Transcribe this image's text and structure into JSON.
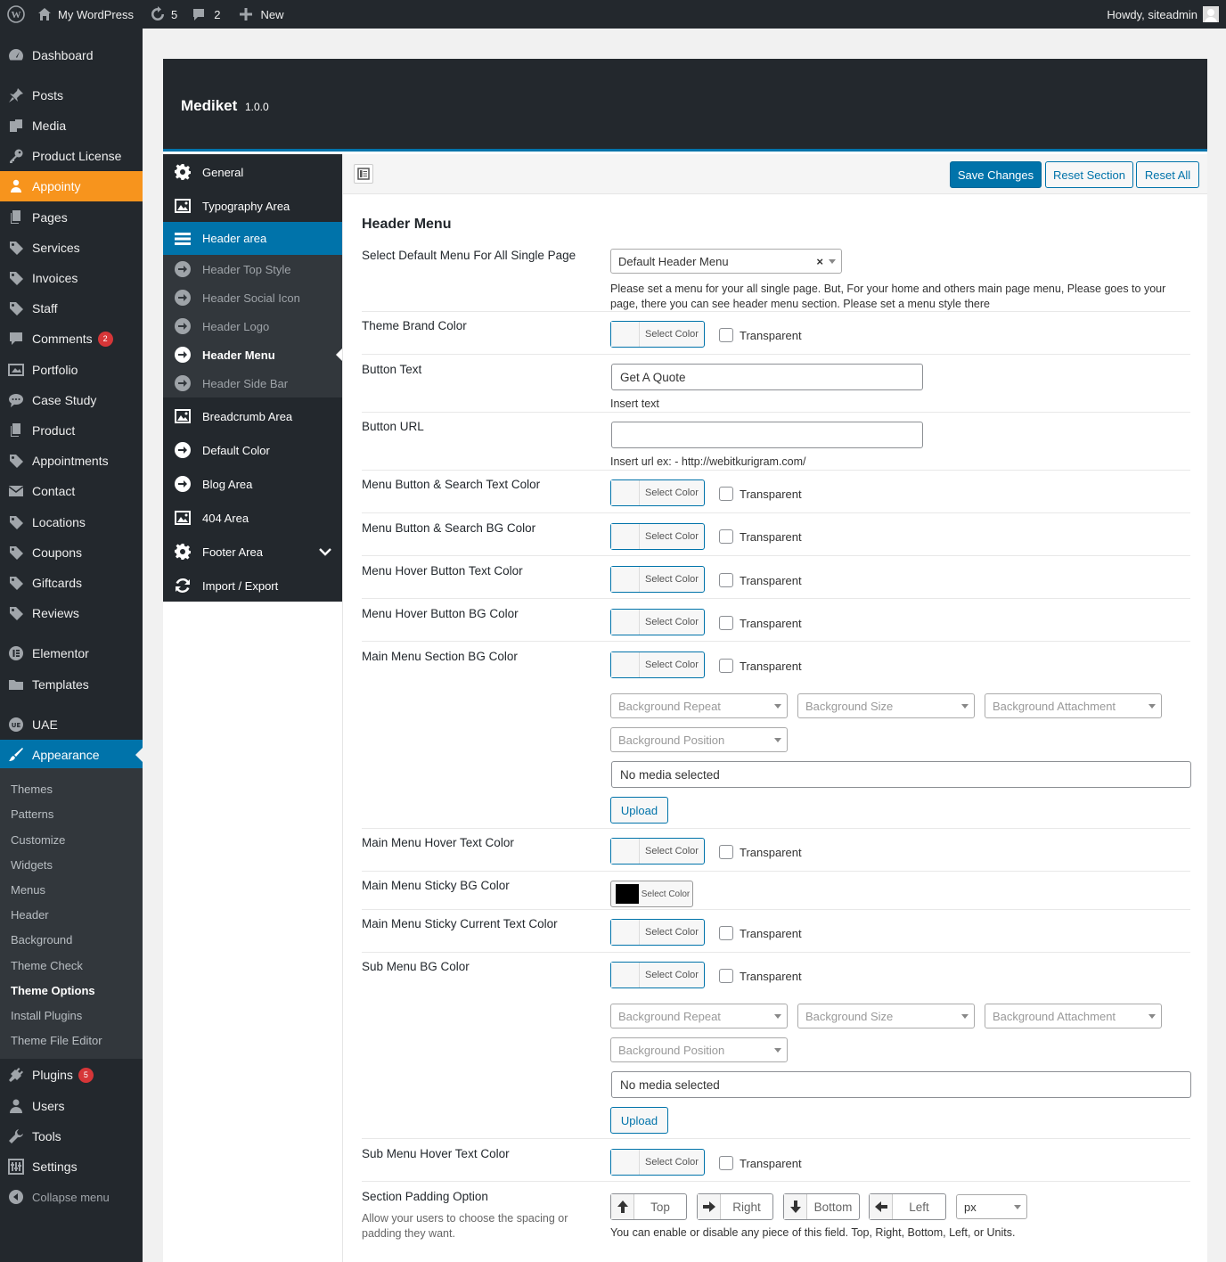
{
  "adminbar": {
    "site_name": "My WordPress",
    "updates_count": "5",
    "comments_count": "2",
    "new_label": "New",
    "howdy": "Howdy, siteadmin"
  },
  "menu": {
    "dashboard": "Dashboard",
    "posts": "Posts",
    "media": "Media",
    "product_license": "Product License",
    "appointy": "Appointy",
    "pages": "Pages",
    "services": "Services",
    "invoices": "Invoices",
    "staff": "Staff",
    "comments": "Comments",
    "comments_badge": "2",
    "portfolio": "Portfolio",
    "case_study": "Case Study",
    "product": "Product",
    "appointments": "Appointments",
    "contact": "Contact",
    "locations": "Locations",
    "coupons": "Coupons",
    "giftcards": "Giftcards",
    "reviews": "Reviews",
    "elementor": "Elementor",
    "templates": "Templates",
    "uae": "UAE",
    "appearance": "Appearance",
    "plugins": "Plugins",
    "plugins_badge": "5",
    "users": "Users",
    "tools": "Tools",
    "settings": "Settings",
    "collapse": "Collapse menu"
  },
  "appearance_sub": {
    "themes": "Themes",
    "patterns": "Patterns",
    "customize": "Customize",
    "widgets": "Widgets",
    "menus": "Menus",
    "header": "Header",
    "background": "Background",
    "theme_check": "Theme Check",
    "theme_options": "Theme Options",
    "install_plugins": "Install Plugins",
    "theme_file_editor": "Theme File Editor"
  },
  "panel": {
    "title": "Mediket",
    "version": "1.0.0"
  },
  "opt_nav": {
    "general": "General",
    "typography": "Typography Area",
    "header_area": "Header area",
    "header_top_style": "Header Top Style",
    "header_social_icon": "Header Social Icon",
    "header_logo": "Header Logo",
    "header_menu": "Header Menu",
    "header_side_bar": "Header Side Bar",
    "breadcrumb": "Breadcrumb Area",
    "default_color": "Default Color",
    "blog_area": "Blog Area",
    "area_404": "404 Area",
    "footer_area": "Footer Area",
    "import_export": "Import / Export"
  },
  "toolbar": {
    "save": "Save Changes",
    "reset_section": "Reset Section",
    "reset_all": "Reset All"
  },
  "form": {
    "section_title": "Header Menu",
    "select_color": "Select Color",
    "transparent": "Transparent",
    "bg_repeat": "Background Repeat",
    "bg_size": "Background Size",
    "bg_attachment": "Background Attachment",
    "bg_position": "Background Position",
    "no_media": "No media selected",
    "upload": "Upload",
    "default_menu_label": "Select Default Menu For All Single Page",
    "default_menu_value": "Default Header Menu",
    "default_menu_help": "Please set a menu for your all single page. But, For your home and others main page menu, Please goes to your page, there you can see header menu section. Please set a menu style there",
    "theme_brand_color": "Theme Brand Color",
    "button_text_label": "Button Text",
    "button_text_value": "Get A Quote",
    "button_text_help": "Insert text",
    "button_url_label": "Button URL",
    "button_url_value": "",
    "button_url_help": "Insert url ex: - http://webitkurigram.com/",
    "menu_btn_text_color": "Menu Button & Search Text Color",
    "menu_btn_bg_color": "Menu Button & Search BG Color",
    "menu_hover_btn_text": "Menu Hover Button Text Color",
    "menu_hover_btn_bg": "Menu Hover Button BG Color",
    "main_menu_section_bg": "Main Menu Section BG Color",
    "main_menu_hover_text": "Main Menu Hover Text Color",
    "main_menu_sticky_bg": "Main Menu Sticky BG Color",
    "sticky_bg_color": "#000000",
    "main_menu_sticky_current": "Main Menu Sticky Current Text Color",
    "sub_menu_bg": "Sub Menu BG Color",
    "sub_menu_hover_text": "Sub Menu Hover Text Color",
    "section_padding_label": "Section Padding Option",
    "section_padding_desc": "Allow your users to choose the spacing or padding they want.",
    "pad_top": "Top",
    "pad_right": "Right",
    "pad_bottom": "Bottom",
    "pad_left": "Left",
    "pad_unit": "px",
    "pad_help": "You can enable or disable any piece of this field. Top, Right, Bottom, Left, or Units."
  },
  "icons": {
    "wp_logo": "wordpress-icon",
    "updates": "refresh-icon",
    "comments": "comment-icon",
    "new": "plus-icon"
  },
  "colors": {
    "accent": "#0073aa",
    "appointy": "#f7941d",
    "admin_dark": "#23282d"
  }
}
